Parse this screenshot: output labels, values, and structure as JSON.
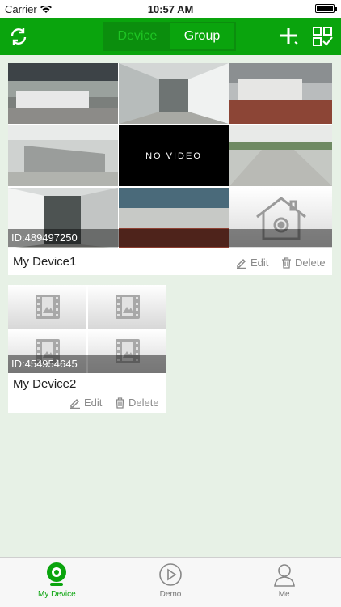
{
  "status": {
    "carrier": "Carrier",
    "time": "10:57 AM"
  },
  "nav": {
    "segments": {
      "device": "Device",
      "group": "Group"
    },
    "active_segment": "Group"
  },
  "devices": [
    {
      "id_label": "ID:489497250",
      "name": "My Device1",
      "edit": "Edit",
      "delete": "Delete",
      "no_video": "NO VIDEO"
    },
    {
      "id_label": "ID:454954645",
      "name": "My Device2",
      "edit": "Edit",
      "delete": "Delete"
    }
  ],
  "tabbar": {
    "items": [
      {
        "label": "My Device",
        "icon": "camera-icon"
      },
      {
        "label": "Demo",
        "icon": "play-icon"
      },
      {
        "label": "Me",
        "icon": "person-icon"
      }
    ],
    "active": "My Device"
  },
  "colors": {
    "brand": "#0aa40d",
    "background": "#e7f1e6"
  }
}
